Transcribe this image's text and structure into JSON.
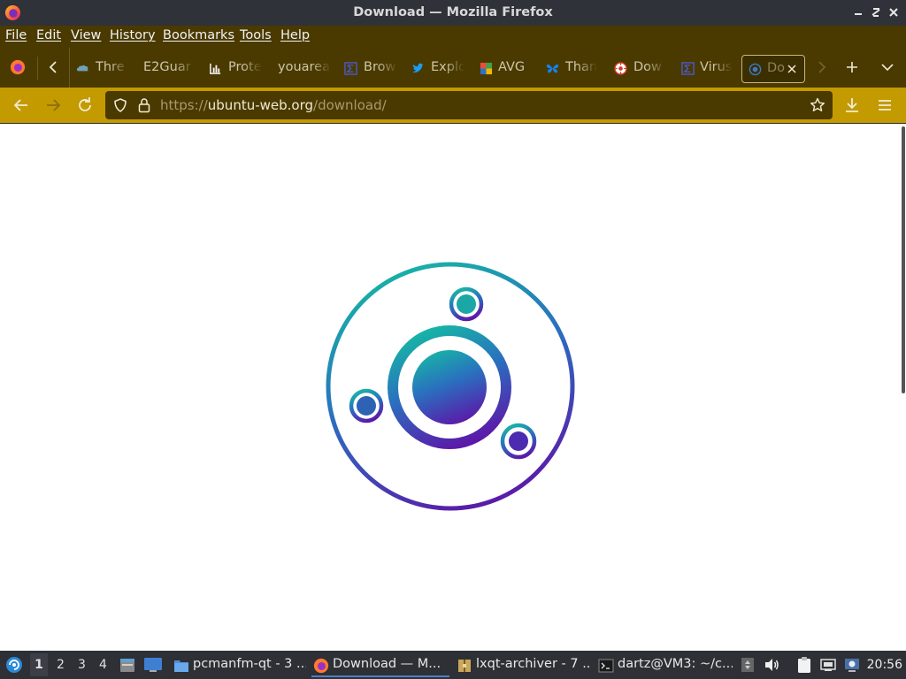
{
  "window": {
    "title": "Download — Mozilla Firefox"
  },
  "menu": {
    "items": [
      "File",
      "Edit",
      "View",
      "History",
      "Bookmarks",
      "Tools",
      "Help"
    ]
  },
  "tabs": [
    {
      "label": "Thre",
      "icon": "cloud-icon"
    },
    {
      "label": "E2Guar",
      "icon": ""
    },
    {
      "label": "Prote",
      "icon": "bar-chart-icon"
    },
    {
      "label": "youarea",
      "icon": ""
    },
    {
      "label": "Brow",
      "icon": "sigma-icon"
    },
    {
      "label": "Explo",
      "icon": "twitter-bird-icon"
    },
    {
      "label": "AVG",
      "icon": "avg-icon"
    },
    {
      "label": "Than",
      "icon": "butterfly-icon"
    },
    {
      "label": "Dow",
      "icon": "target-icon"
    },
    {
      "label": "Virus",
      "icon": "sigma-icon"
    },
    {
      "label": "Do",
      "icon": "globe-icon",
      "active": true
    }
  ],
  "navbar": {
    "url_prefix": "https://",
    "url_host": "ubuntu-web.org",
    "url_path": "/download/"
  },
  "colors": {
    "menu_bg": "#4a3a00",
    "toolbar_bg": "#c39a00",
    "logo_teal": "#17b3a6",
    "logo_purple": "#5d16a8",
    "taskbar_bg": "#2e3035"
  },
  "taskbar": {
    "workspaces": [
      "1",
      "2",
      "3",
      "4"
    ],
    "active_workspace": "1",
    "tasks": [
      {
        "label": "pcmanfm-qt - 3 ...",
        "icon": "folder-icon"
      },
      {
        "label": "Download — M...",
        "icon": "firefox-icon",
        "active": true
      },
      {
        "label": "lxqt-archiver - 7 ...",
        "icon": "archive-icon"
      },
      {
        "label": "dartz@VM3: ~/c...",
        "icon": "terminal-icon"
      }
    ],
    "clock": "20:56"
  }
}
